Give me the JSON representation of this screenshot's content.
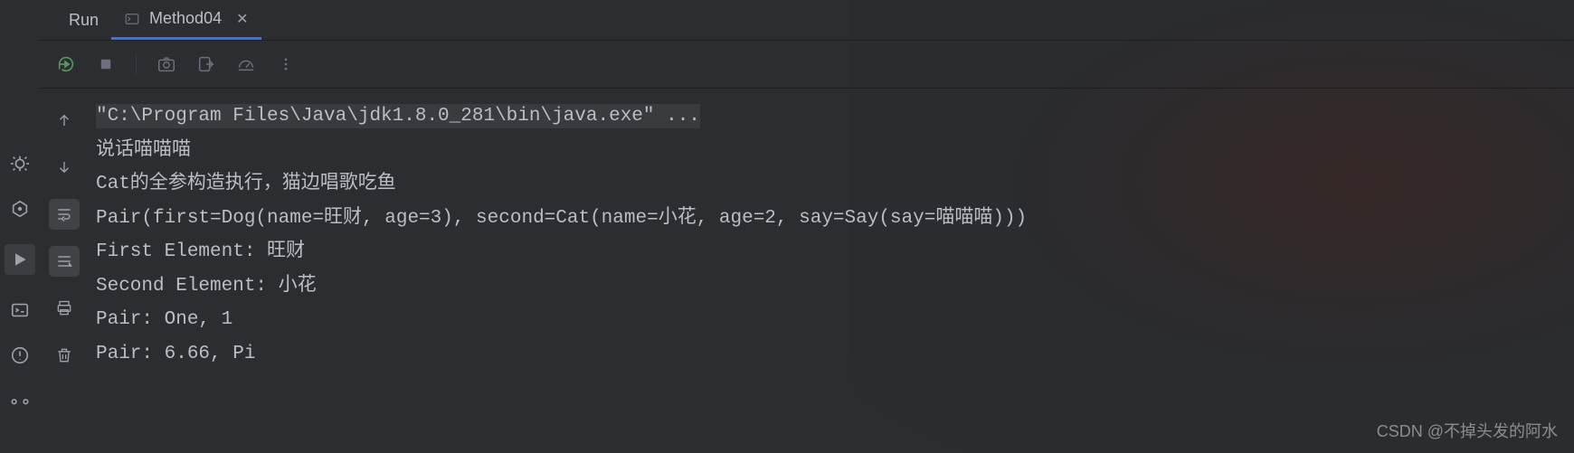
{
  "tabs": {
    "run_label": "Run",
    "file_label": "Method04"
  },
  "console": {
    "command": "\"C:\\Program Files\\Java\\jdk1.8.0_281\\bin\\java.exe\" ...",
    "lines": [
      "说话喵喵喵",
      "Cat的全参构造执行，猫边唱歌吃鱼",
      "Pair(first=Dog(name=旺财, age=3), second=Cat(name=小花, age=2, say=Say(say=喵喵喵)))",
      "First Element: 旺财",
      "Second Element: 小花",
      "Pair: One, 1",
      "Pair: 6.66, Pi"
    ]
  },
  "watermark": "CSDN @不掉头发的阿水"
}
